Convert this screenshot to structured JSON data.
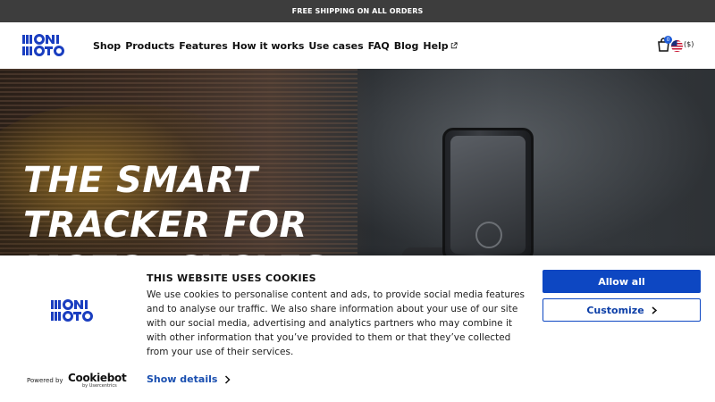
{
  "announcement": {
    "text": "FREE SHIPPING ON ALL ORDERS"
  },
  "header": {
    "logo_alt": "MONIMOTO",
    "nav": [
      "Shop",
      "Products",
      "Features",
      "How it works",
      "Use cases",
      "FAQ",
      "Blog",
      "Help"
    ],
    "cart_count": "0",
    "currency": "($)"
  },
  "hero": {
    "headline": "THE SMART TRACKER FOR MOTORCYCLES"
  },
  "cookie_banner": {
    "title": "THIS WEBSITE USES COOKIES",
    "body": "We use cookies to personalise content and ads, to provide social media features and to analyse our traffic. We also share information about your use of our site with our social media, advertising and analytics partners who may combine it with other information that you’ve provided to them or that they’ve collected from your use of their services.",
    "show_details": "Show details",
    "allow_all": "Allow all",
    "customize": "Customize",
    "powered_by": "Powered by",
    "cookiebot": "Cookiebot",
    "cookiebot_sub": "by Usercentrics"
  },
  "colors": {
    "brand_blue": "#0d47c2",
    "announce_bg": "#3d3d3d"
  }
}
